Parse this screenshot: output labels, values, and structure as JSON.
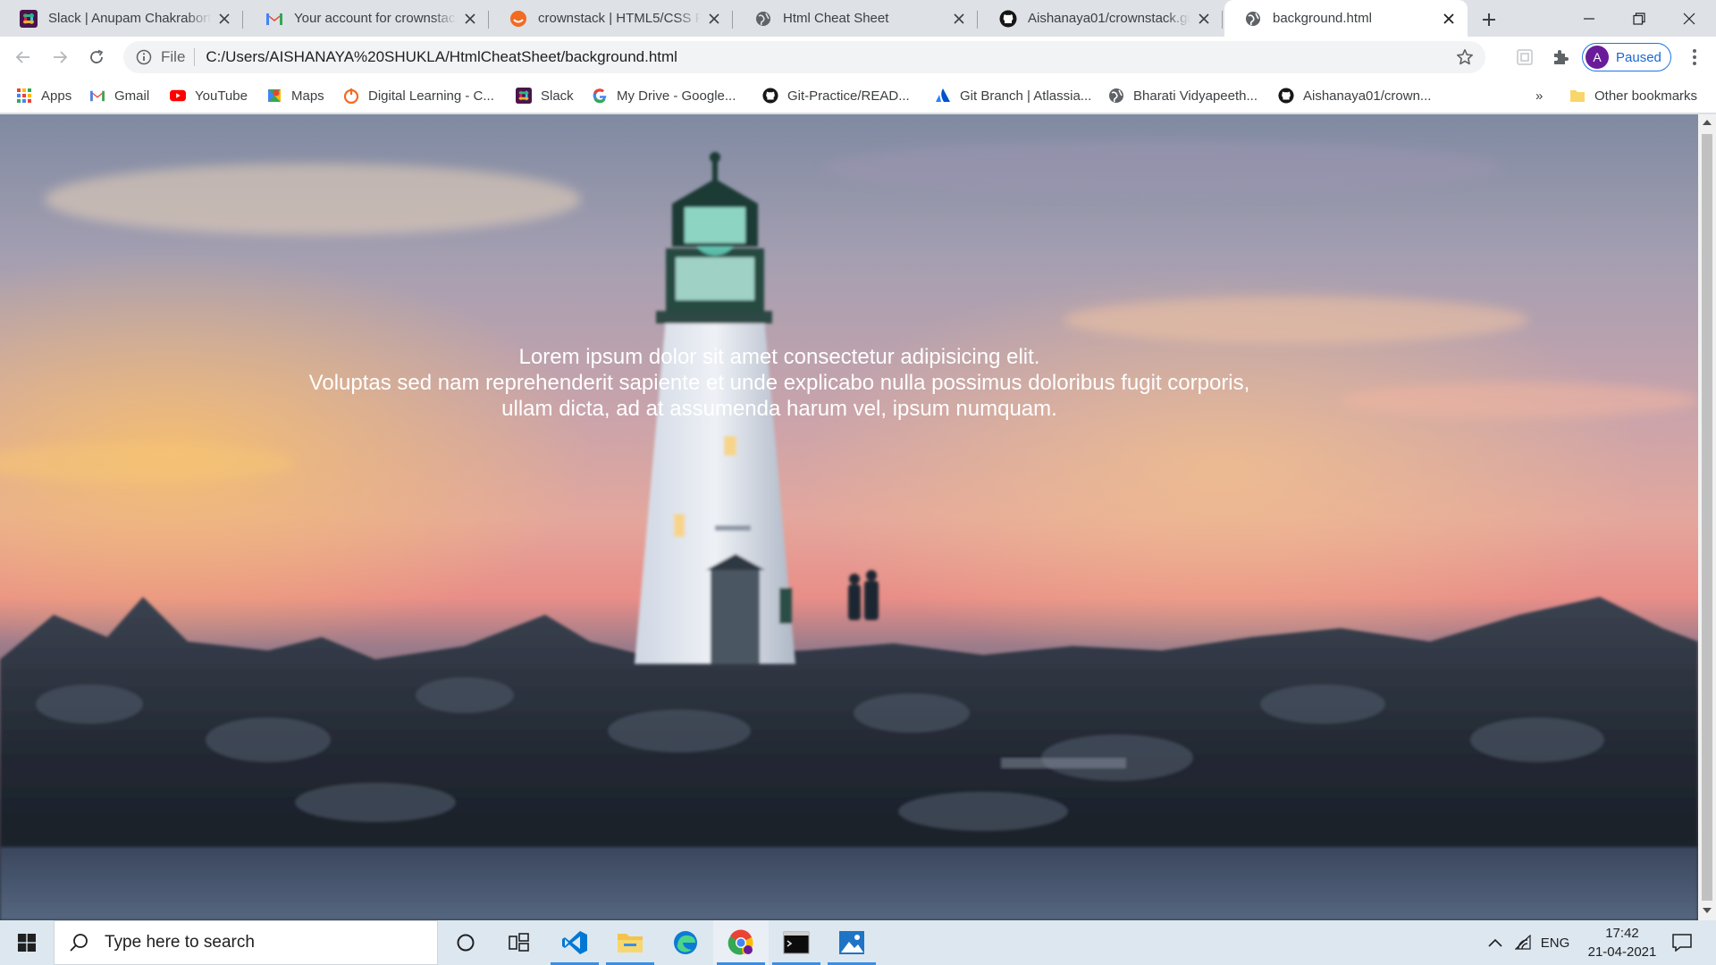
{
  "tabs": [
    {
      "title": "Slack | Anupam Chakraborty",
      "icon": "slack-icon"
    },
    {
      "title": "Your account for crownstack",
      "icon": "gmail-icon"
    },
    {
      "title": "crownstack | HTML5/CSS For",
      "icon": "crownstack-icon"
    },
    {
      "title": "Html Cheat Sheet",
      "icon": "globe-icon"
    },
    {
      "title": "Aishanaya01/crownstack.gith",
      "icon": "github-icon"
    },
    {
      "title": "background.html",
      "icon": "globe-icon",
      "active": true
    }
  ],
  "address_bar": {
    "scheme_label": "File",
    "url": "C:/Users/AISHANAYA%20SHUKLA/HtmlCheatSheet/background.html"
  },
  "profile": {
    "initial": "A",
    "status": "Paused"
  },
  "bookmarks": [
    {
      "label": "Apps",
      "icon": "apps-grid-icon"
    },
    {
      "label": "Gmail",
      "icon": "gmail-icon"
    },
    {
      "label": "YouTube",
      "icon": "youtube-icon"
    },
    {
      "label": "Maps",
      "icon": "maps-icon"
    },
    {
      "label": "Digital Learning - C...",
      "icon": "digital-learning-icon"
    },
    {
      "label": "Slack",
      "icon": "slack-icon"
    },
    {
      "label": "My Drive - Google...",
      "icon": "google-icon"
    },
    {
      "label": "Git-Practice/READ...",
      "icon": "github-icon"
    },
    {
      "label": "Git Branch | Atlassia...",
      "icon": "atlassian-icon"
    },
    {
      "label": "Bharati Vidyapeeth...",
      "icon": "globe-icon"
    },
    {
      "label": "Aishanaya01/crown...",
      "icon": "github-icon"
    }
  ],
  "bookmarks_overflow": "»",
  "other_bookmarks": "Other bookmarks",
  "page": {
    "line1": "Lorem ipsum dolor sit amet consectetur adipisicing elit.",
    "line2": "Voluptas sed nam reprehenderit sapiente et unde explicabo nulla possimus doloribus fugit corporis,",
    "line3": "ullam dicta, ad at assumenda harum vel, ipsum numquam.",
    "background": "lighthouse-sunset-photo"
  },
  "taskbar": {
    "search_placeholder": "Type here to search",
    "apps": [
      "cortana-icon",
      "task-view-icon",
      "vscode-icon",
      "file-explorer-icon",
      "edge-icon",
      "chrome-icon",
      "terminal-icon",
      "photos-icon"
    ],
    "language": "ENG",
    "time": "17:42",
    "date": "21-04-2021"
  },
  "colors": {
    "accent": "#1a73e8",
    "profile_avatar": "#6a1b9a",
    "taskbar": "#dde7f0"
  }
}
